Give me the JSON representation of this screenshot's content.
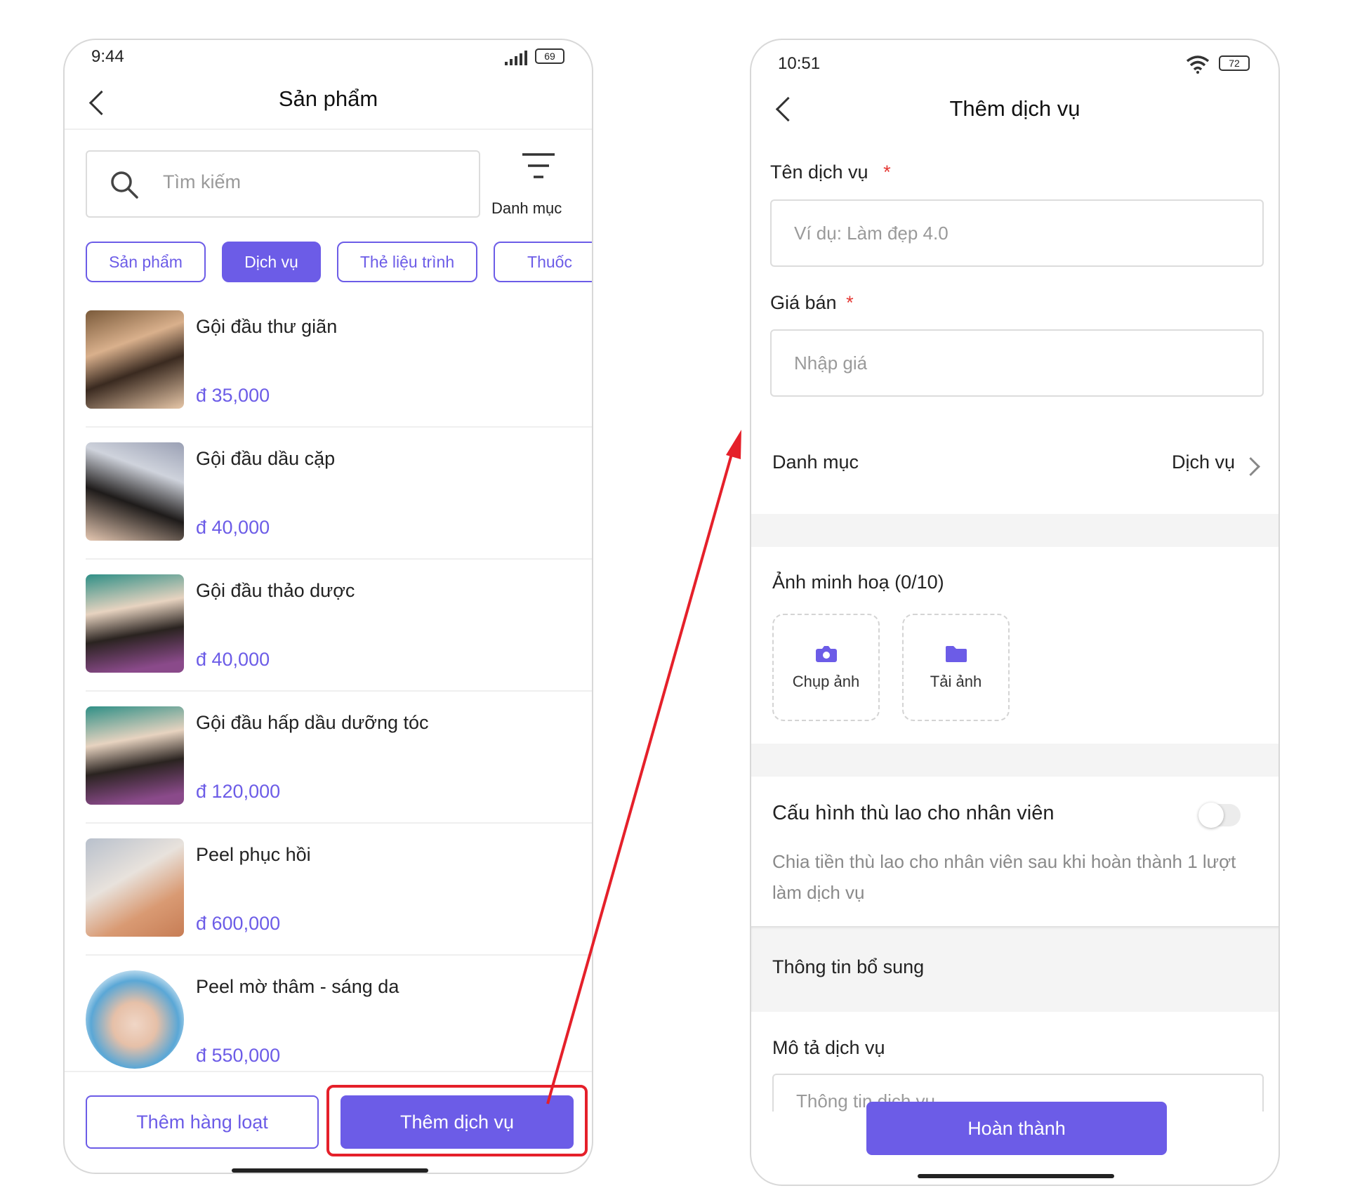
{
  "left": {
    "status": {
      "time": "9:44",
      "battery": "69"
    },
    "header": {
      "title": "Sản phẩm"
    },
    "search": {
      "placeholder": "Tìm kiếm"
    },
    "filter": {
      "label": "Danh mục"
    },
    "tabs": [
      {
        "label": "Sản phẩm",
        "active": false
      },
      {
        "label": "Dịch vụ",
        "active": true
      },
      {
        "label": "Thẻ liệu trình",
        "active": false
      },
      {
        "label": "Thuốc",
        "active": false
      }
    ],
    "items": [
      {
        "name": "Gội đầu thư giãn",
        "price": "đ 35,000"
      },
      {
        "name": "Gội đầu dầu cặp",
        "price": "đ 40,000"
      },
      {
        "name": "Gội đầu thảo dược",
        "price": "đ 40,000"
      },
      {
        "name": "Gội đầu hấp dầu dưỡng tóc",
        "price": "đ 120,000"
      },
      {
        "name": "Peel phục hồi",
        "price": "đ 600,000"
      },
      {
        "name": "Peel mờ thâm - sáng da",
        "price": "đ 550,000"
      }
    ],
    "footer": {
      "bulk_label": "Thêm hàng loạt",
      "add_label": "Thêm dịch vụ"
    }
  },
  "right": {
    "status": {
      "time": "10:51",
      "battery": "72"
    },
    "header": {
      "title": "Thêm dịch vụ"
    },
    "form": {
      "name_label": "Tên dịch vụ",
      "name_placeholder": "Ví dụ: Làm đẹp 4.0",
      "price_label": "Giá bán",
      "price_placeholder": "Nhập giá",
      "required_mark": "*",
      "category_label": "Danh mục",
      "category_value": "Dịch vụ",
      "images_label": "Ảnh minh hoạ (0/10)",
      "capture_label": "Chụp ảnh",
      "upload_label": "Tải ảnh",
      "commission_title": "Cấu hình thù lao cho nhân viên",
      "commission_desc": "Chia tiền thù lao cho nhân viên sau khi hoàn thành 1 lượt làm dịch vụ",
      "commission_enabled": false,
      "extra_section": "Thông tin bổ sung",
      "desc_label": "Mô tả dịch vụ",
      "desc_placeholder": "Thông tin dịch vụ"
    },
    "footer": {
      "submit_label": "Hoàn thành"
    }
  },
  "colors": {
    "accent": "#6c5ce7",
    "annotation": "#e5202a",
    "required": "#e53935"
  }
}
